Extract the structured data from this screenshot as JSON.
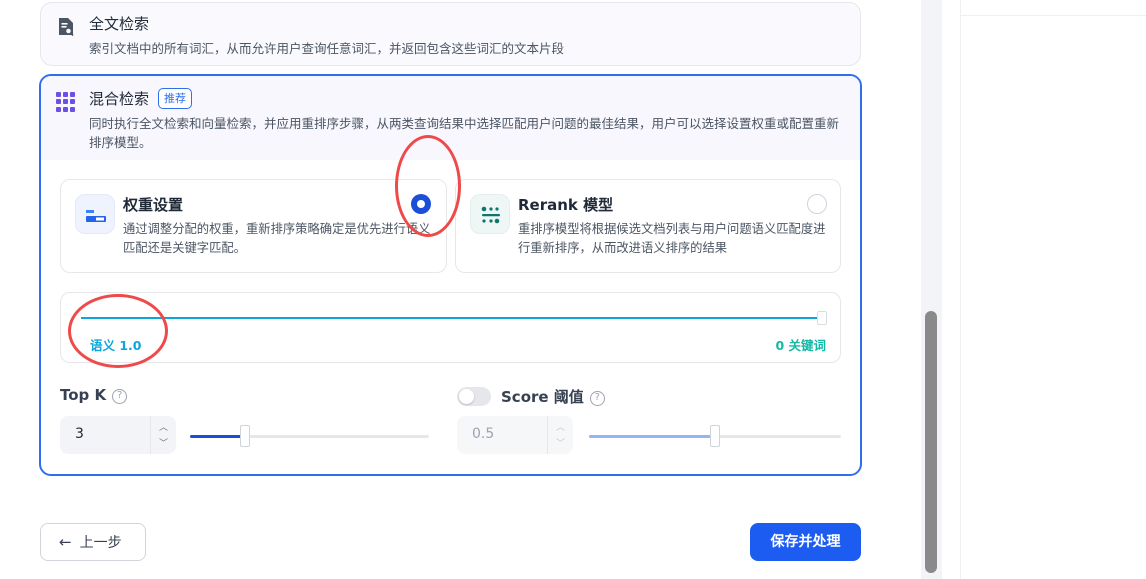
{
  "fulltext": {
    "title": "全文检索",
    "description": "索引文档中的所有词汇，从而允许用户查询任意词汇，并返回包含这些词汇的文本片段",
    "icon": "document-search-icon"
  },
  "hybrid": {
    "title": "混合检索",
    "badge": "推荐",
    "description": "同时执行全文检索和向量检索，并应用重排序步骤，从两类查询结果中选择匹配用户问题的最佳结果，用户可以选择设置权重或配置重新排序模型。",
    "icon": "grid-dots-icon"
  },
  "options": {
    "weight": {
      "title": "权重设置",
      "description": "通过调整分配的权重，重新排序策略确定是优先进行语义匹配还是关键字匹配。",
      "selected": true,
      "icon": "weight-icon"
    },
    "rerank": {
      "title": "Rerank 模型",
      "description": "重排序模型将根据候选文档列表与用户问题语义匹配度进行重新排序，从而改进语义排序的结果",
      "selected": false,
      "icon": "rerank-icon"
    }
  },
  "weight_slider": {
    "left_label": "语义 1.0",
    "right_label": "0 关键词",
    "semantic_weight": 1.0
  },
  "top_k": {
    "label": "Top K",
    "value": "3",
    "slider_fraction": 0.23
  },
  "score": {
    "label": "Score 阈值",
    "value": "0.5",
    "enabled": false,
    "slider_fraction": 0.5
  },
  "buttons": {
    "back": "上一步",
    "save": "保存并处理"
  },
  "colors": {
    "accent": "#1d5cf0",
    "annotation": "#ef4a4a"
  }
}
